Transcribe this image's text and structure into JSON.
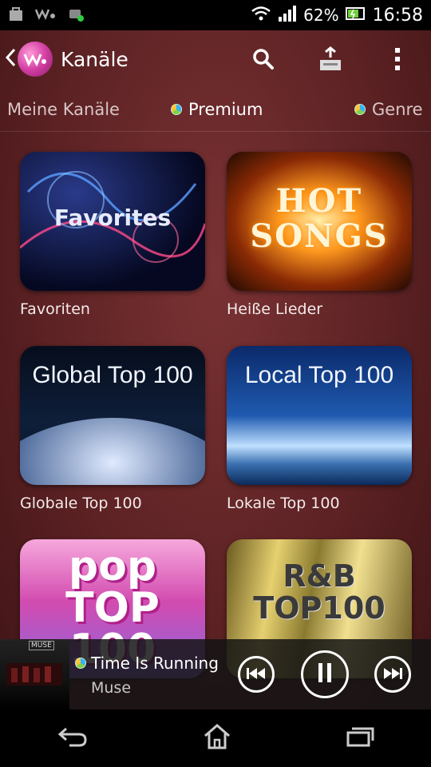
{
  "status_bar": {
    "battery_percent": "62%",
    "time": "16:58",
    "left_icons": [
      "bag-icon",
      "walkman-icon",
      "android-icon"
    ],
    "right_icons": [
      "wifi-icon",
      "signal-icon",
      "battery-icon"
    ]
  },
  "app_bar": {
    "title": "Kanäle",
    "icons": [
      "back-chevron-icon",
      "walkman-logo-icon",
      "search-icon",
      "upload-icon",
      "overflow-menu-icon"
    ]
  },
  "tabs": [
    {
      "label": "Meine Kanäle",
      "active": false
    },
    {
      "label": "Premium",
      "active": true
    },
    {
      "label": "Genre",
      "active": false
    }
  ],
  "channels": [
    {
      "label": "Favoriten",
      "art_text": "Favorites"
    },
    {
      "label": "Heiße Lieder",
      "art_text": "HOT SONGS"
    },
    {
      "label": "Globale Top 100",
      "art_text": "Global Top 100"
    },
    {
      "label": "Lokale Top 100",
      "art_text": "Local Top 100"
    },
    {
      "label": "",
      "art_text": "pop TOP 100"
    },
    {
      "label": "",
      "art_text": "R&B TOP100"
    }
  ],
  "now_playing": {
    "title": "Time Is Running O",
    "artist": "Muse",
    "cover_text": "MUSE",
    "controls": [
      "previous-icon",
      "pause-icon",
      "next-icon"
    ]
  },
  "nav_bar": {
    "icons": [
      "back-icon",
      "home-icon",
      "recent-apps-icon"
    ]
  },
  "colors": {
    "background": "#5d2224",
    "accent": "#ffffff"
  }
}
